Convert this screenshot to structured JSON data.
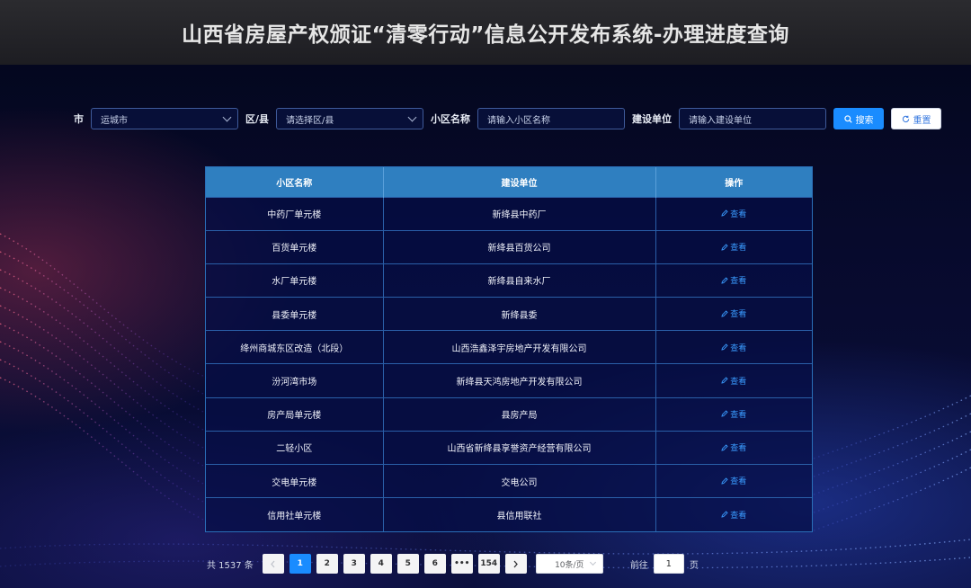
{
  "header": {
    "title": "山西省房屋产权颁证“清零行动”信息公开发布系统-办理进度查询"
  },
  "filters": {
    "city_label": "市",
    "city_value": "运城市",
    "district_label": "区/县",
    "district_placeholder": "请选择区/县",
    "community_label": "小区名称",
    "community_placeholder": "请输入小区名称",
    "builder_label": "建设单位",
    "builder_placeholder": "请输入建设单位",
    "search_label": "搜索",
    "reset_label": "重置"
  },
  "table": {
    "columns": [
      "小区名称",
      "建设单位",
      "操作"
    ],
    "action_label": "查看",
    "rows": [
      {
        "name": "中药厂单元楼",
        "builder": "新绛县中药厂"
      },
      {
        "name": "百货单元楼",
        "builder": "新绛县百货公司"
      },
      {
        "name": "水厂单元楼",
        "builder": "新绛县自来水厂"
      },
      {
        "name": "县委单元楼",
        "builder": "新绛县委"
      },
      {
        "name": "绛州商城东区改造（北段）",
        "builder": "山西浩鑫泽宇房地产开发有限公司"
      },
      {
        "name": "汾河湾市场",
        "builder": "新绛县天鸿房地产开发有限公司"
      },
      {
        "name": "房产局单元楼",
        "builder": "县房产局"
      },
      {
        "name": "二轻小区",
        "builder": "山西省新绛县享誉资产经营有限公司"
      },
      {
        "name": "交电单元楼",
        "builder": "交电公司"
      },
      {
        "name": "信用社单元楼",
        "builder": "县信用联社"
      }
    ]
  },
  "pagination": {
    "total_text": "共 1537 条",
    "pages": [
      "1",
      "2",
      "3",
      "4",
      "5",
      "6",
      "•••",
      "154"
    ],
    "current_page": "1",
    "page_size": "10条/页",
    "goto_label": "前往",
    "goto_value": "1",
    "page_suffix": "页"
  },
  "colors": {
    "primary": "#1a8cff",
    "table_header": "#2f7fc0",
    "link": "#3a9bff"
  }
}
